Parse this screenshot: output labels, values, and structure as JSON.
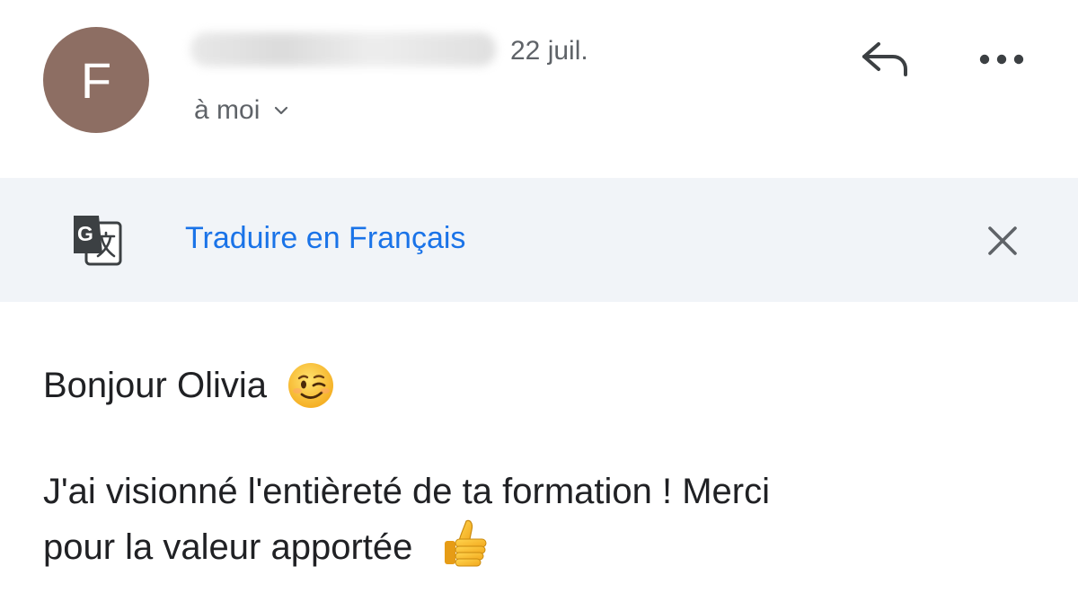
{
  "header": {
    "avatar_letter": "F",
    "sender_name": "",
    "date": "22 juil.",
    "recipient": "à moi",
    "icons": {
      "reply": "reply-icon",
      "more": "more-horizontal-icon",
      "chevron": "chevron-down-icon"
    }
  },
  "translate_bar": {
    "icon": "google-translate-icon",
    "link_label": "Traduire en Français",
    "close_icon": "close-icon"
  },
  "message": {
    "greeting": "Bonjour Olivia",
    "greeting_emoji": "winking-face-emoji",
    "line1": "J'ai visionné l'entièreté de ta formation ! Merci",
    "line2": "pour la valeur apportée",
    "closing_emoji": "thumbs-up-emoji"
  },
  "colors": {
    "avatar_bg": "#8d6e63",
    "link": "#1a73e8",
    "translate_bar_bg": "#f1f4f8",
    "secondary_text": "#5f6368",
    "primary_text": "#202124"
  }
}
